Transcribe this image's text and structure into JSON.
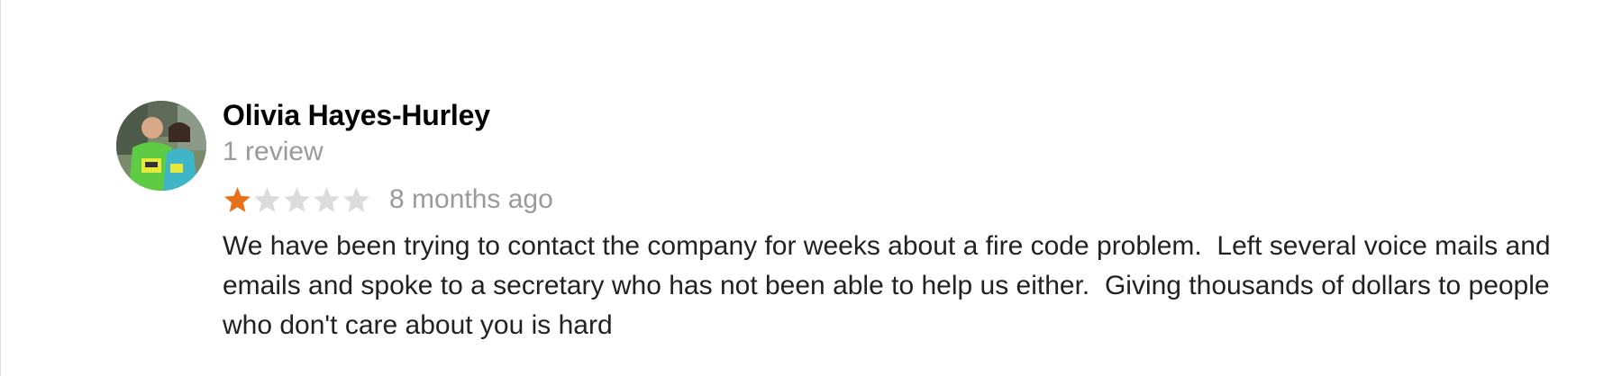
{
  "review": {
    "author": "Olivia Hayes-Hurley",
    "review_count": "1 review",
    "rating": 1,
    "rating_max": 5,
    "relative_time": "8 months ago",
    "text": "We have been trying to contact the company for weeks about a fire code problem.  Left several voice mails and emails and spoke to a secretary who has not been able to help us either.  Giving thousands of dollars to people who don't care about you is hard",
    "avatar_icon": "profile-photo",
    "star_filled_color": "#e7711b",
    "star_empty_color": "#dcdcdc"
  }
}
